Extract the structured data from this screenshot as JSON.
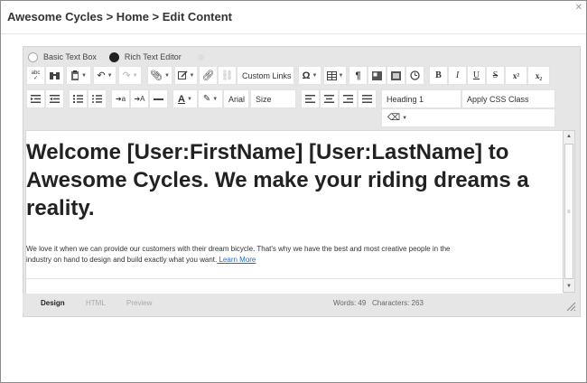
{
  "header": {
    "breadcrumb": "Awesome Cycles > Home > Edit Content"
  },
  "mode": {
    "basic_label": "Basic Text Box",
    "rich_label": "Rich Text Editor",
    "selected": "rich"
  },
  "toolbar": {
    "custom_links": "Custom Links",
    "font_name": "Arial",
    "font_size": "Size",
    "heading": "Heading 1",
    "css_class": "Apply CSS Class",
    "abc": "abc",
    "bold": "B",
    "italic": "I",
    "underline": "U",
    "strike": "S",
    "superscript": "x²",
    "subscript": "x₂",
    "paragraph": "¶",
    "omega": "Ω"
  },
  "content": {
    "heading": "Welcome [User:FirstName] [User:LastName] to Awesome Cycles. We make your riding dreams a reality.",
    "paragraph": "We love it when we can provide our customers with their dream bicycle. That's why we have the best and most creative people in the industry on hand to design and build exactly what you want.",
    "link": " Learn More"
  },
  "footer": {
    "tab_design": "Design",
    "tab_html": "HTML",
    "tab_preview": "Preview",
    "words": "Words: 49",
    "characters": "Characters: 263"
  }
}
